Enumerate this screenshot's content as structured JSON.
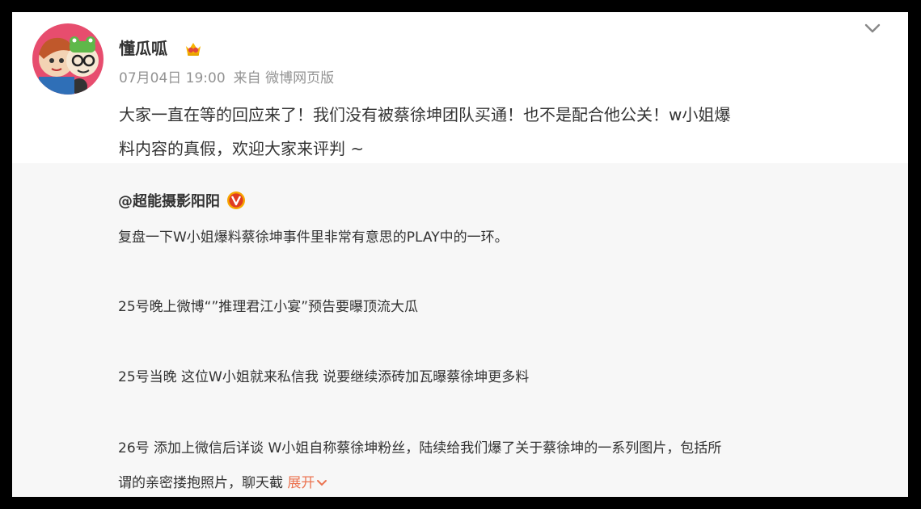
{
  "post": {
    "username": "懂瓜呱",
    "timestamp": "07月04日 19:00",
    "source": "来自 微博网页版",
    "text_line1": "大家一直在等的回应来了！我们没有被蔡徐坤团队买通！也不是配合他公关！w小姐爆",
    "text_line2": "料内容的真假，欢迎大家来评判 ~"
  },
  "repost": {
    "author": "@超能摄影阳阳",
    "lines": [
      "复盘一下W小姐爆料蔡徐坤事件里非常有意思的PLAY中的一环。",
      "25号晚上微博“”推理君江小宴”预告要曝顶流大瓜",
      "25号当晚 这位W小姐就来私信我 说要继续添砖加瓦曝蔡徐坤更多料",
      "26号 添加上微信后详谈 W小姐自称蔡徐坤粉丝，陆续给我们爆了关于蔡徐坤的一系列图片，包括所",
      "谓的亲密搂抱照片，聊天截"
    ],
    "expand_label": "展开"
  },
  "icons": {
    "chevron": "chevron-down-icon",
    "vip": "vip-crown-badge-icon",
    "verified": "orange-v-verified-icon"
  },
  "colors": {
    "accent": "#eb7350",
    "meta_gray": "#939393",
    "repost_bg": "#f7f7f7"
  }
}
